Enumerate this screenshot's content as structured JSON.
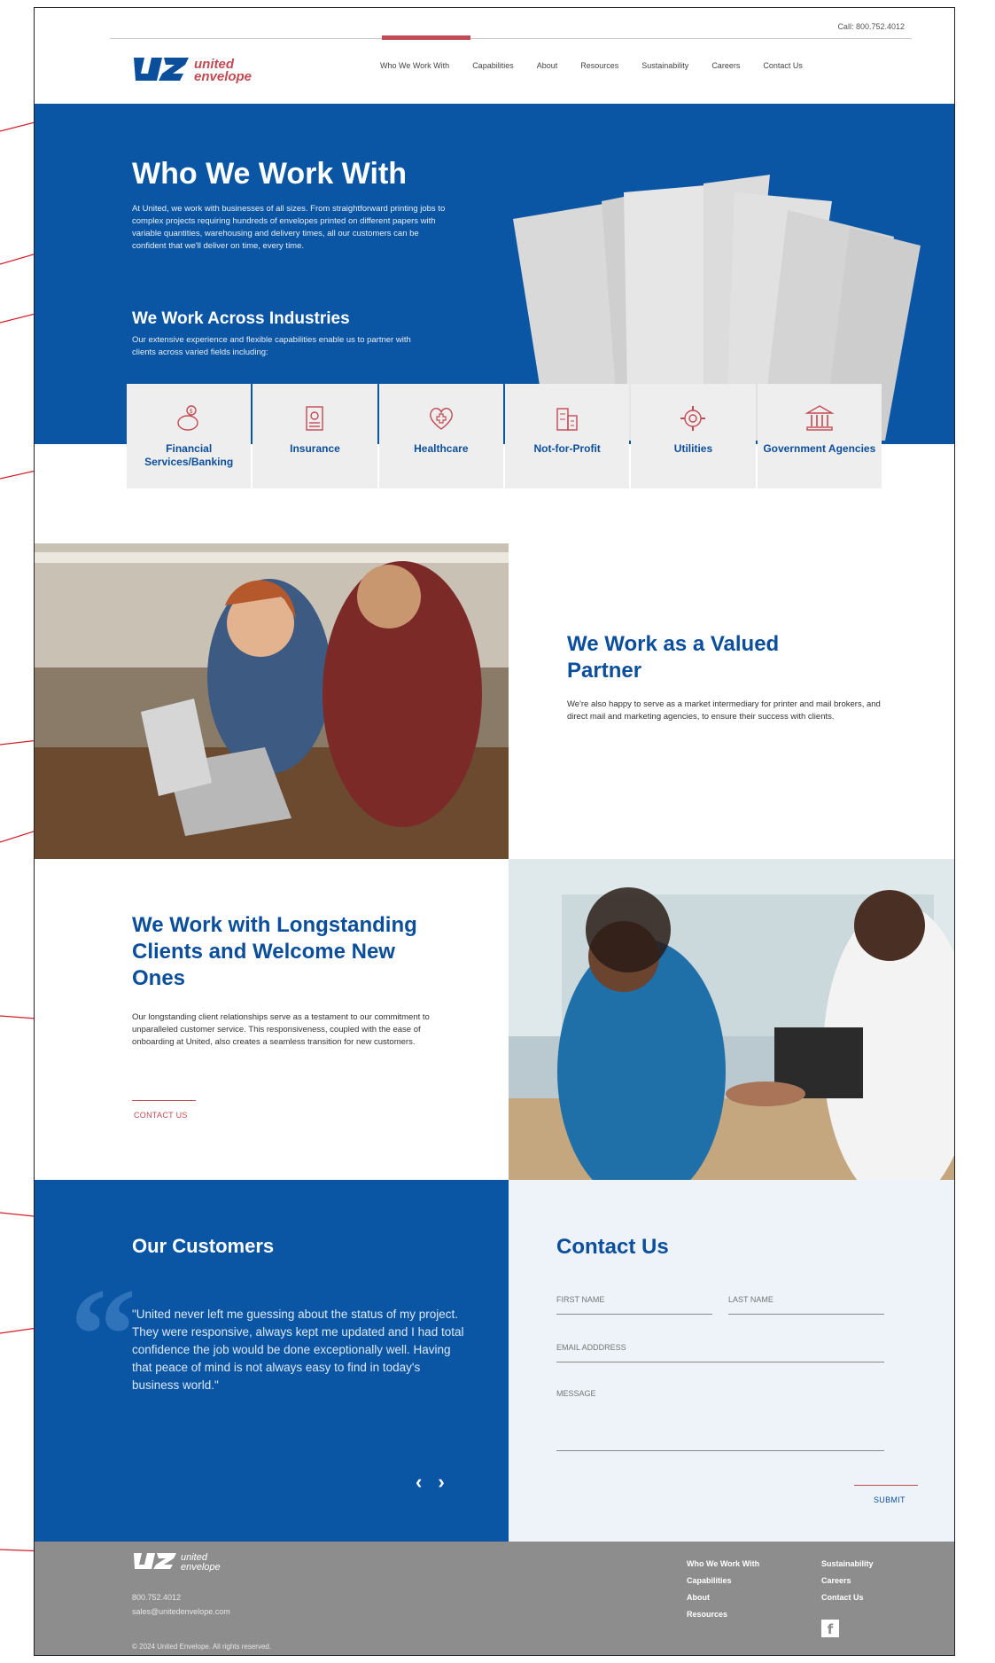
{
  "header": {
    "call": "Call: 800.752.4012",
    "logo_text_1": "united",
    "logo_text_2": "envelope",
    "nav": [
      "Who We Work With",
      "Capabilities",
      "About",
      "Resources",
      "Sustainability",
      "Careers",
      "Contact Us"
    ]
  },
  "hero": {
    "title": "Who We Work With",
    "text": "At United, we work with businesses of all sizes.  From straightforward printing jobs to complex projects requiring hundreds of envelopes printed on different papers with variable quantities, warehousing and delivery times, all our customers can be confident that we'll deliver on time, every time.",
    "sub_title": "We Work Across Industries",
    "sub_text": "Our extensive experience and flexible capabilities enable us to partner with clients across varied fields including:"
  },
  "industries": [
    {
      "label": "Financial Services/Banking",
      "icon": "piggy-bank-icon"
    },
    {
      "label": "Insurance",
      "icon": "clipboard-icon"
    },
    {
      "label": "Healthcare",
      "icon": "heart-plus-icon"
    },
    {
      "label": "Not-for-Profit",
      "icon": "building-icon"
    },
    {
      "label": "Utilities",
      "icon": "gear-icon"
    },
    {
      "label": "Government Agencies",
      "icon": "government-icon"
    }
  ],
  "partner": {
    "title": "We Work as a Valued Partner",
    "text": "We're also happy to serve as a market intermediary for printer and mail brokers, and direct mail and marketing agencies, to ensure their success with clients."
  },
  "longstanding": {
    "title": "We Work with Longstanding Clients and Welcome New Ones",
    "text": "Our longstanding client relationships serve as a testament to our commitment to unparalleled customer service.  This responsiveness, coupled with the ease of onboarding at United, also creates a seamless transition for new customers.",
    "link": "CONTACT US"
  },
  "customers": {
    "title": "Our Customers",
    "quote": "\"United never left me guessing about the status of my project. They were responsive, always kept me updated and I had total confidence the job would be done exceptionally well. Having that peace of mind is not always easy to find in today's business world.\"",
    "prev": "‹",
    "next": "›"
  },
  "contact": {
    "title": "Contact Us",
    "first_name": "FIRST NAME",
    "last_name": "LAST NAME",
    "email": "EMAIL ADDDRESS",
    "message": "MESSAGE",
    "submit": "SUBMIT"
  },
  "footer": {
    "logo_text_1": "united",
    "logo_text_2": "envelope",
    "phone": "800.752.4012",
    "email": "sales@unitedenvelope.com",
    "copyright": "© 2024 United Envelope. All rights reserved.",
    "col1": [
      "Who We Work With",
      "Capabilities",
      "About",
      "Resources"
    ],
    "col2": [
      "Sustainability",
      "Careers",
      "Contact Us"
    ],
    "social": "f"
  },
  "colors": {
    "brand_blue": "#0a56a4",
    "accent_red": "#c24a53",
    "footer_gray": "#8d8d8d"
  }
}
